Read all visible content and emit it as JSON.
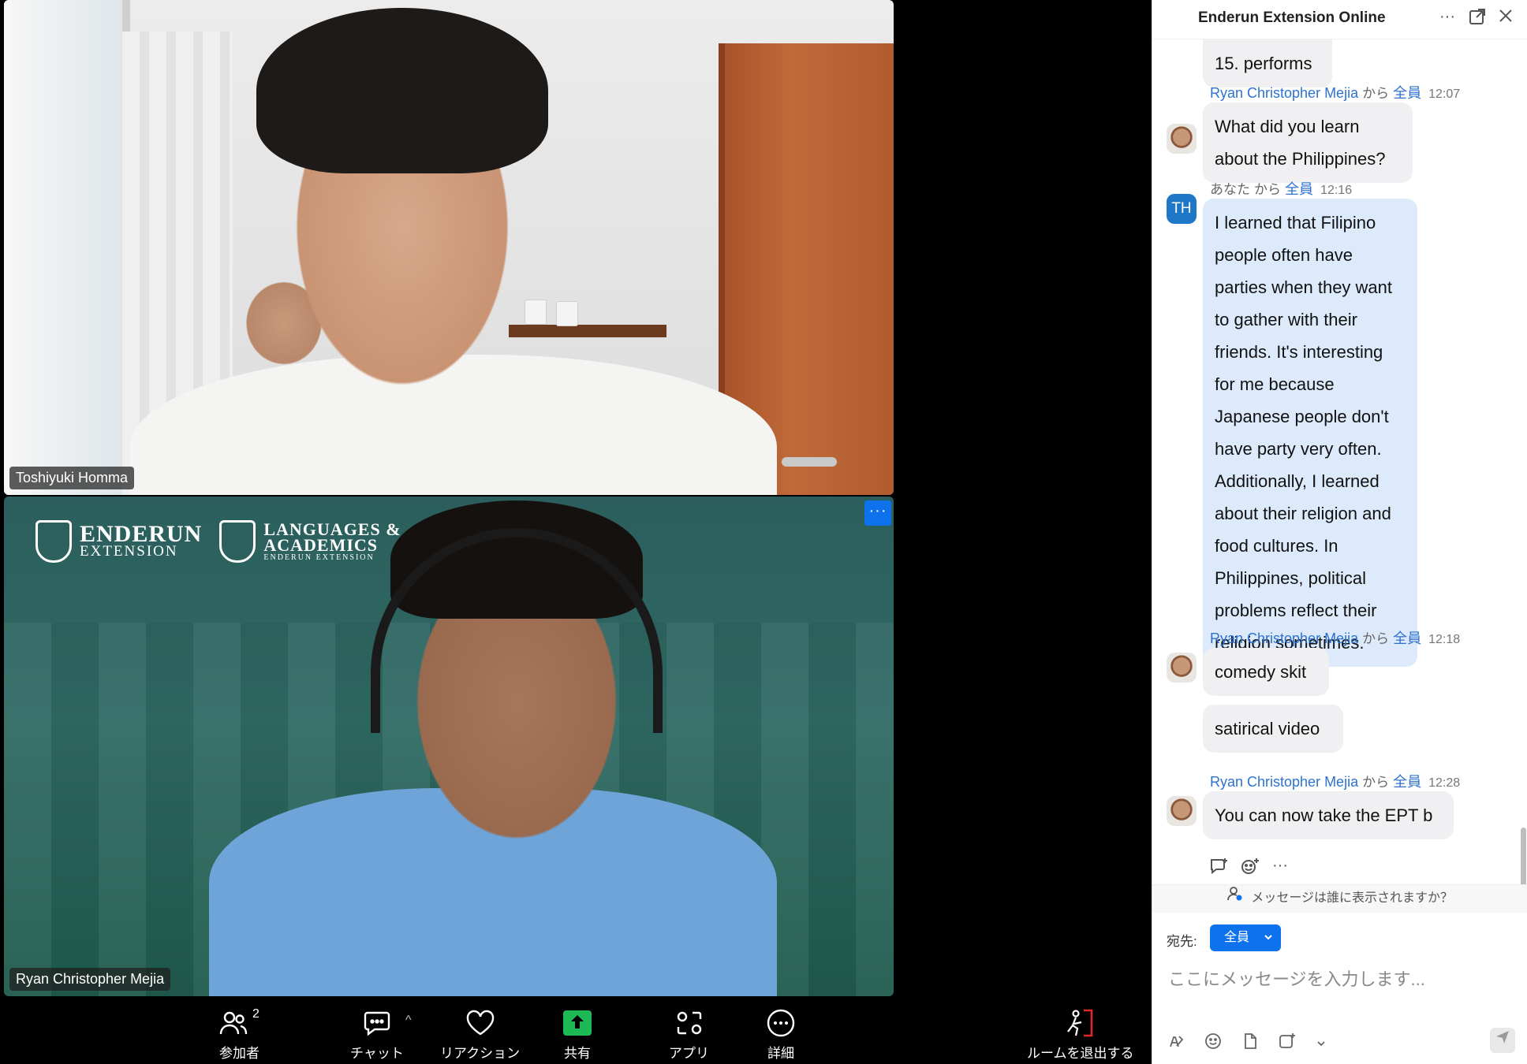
{
  "participants": {
    "top": {
      "name": "Toshiyuki Homma"
    },
    "bottom": {
      "name": "Ryan Christopher Mejia",
      "more_label": "···",
      "background_logo": {
        "brand1_main": "ENDERUN",
        "brand1_sub": "EXTENSION",
        "brand2_line1": "LANGUAGES &",
        "brand2_line2": "ACADEMICS",
        "brand2_small": "ENDERUN EXTENSION"
      }
    }
  },
  "toolbar": {
    "participants": {
      "label": "参加者",
      "count": "2",
      "icon": "participants-icon"
    },
    "chat": {
      "label": "チャット",
      "icon": "chat-icon",
      "caret": "^"
    },
    "reactions": {
      "label": "リアクション",
      "icon": "heart-icon"
    },
    "share": {
      "label": "共有",
      "icon": "share-icon"
    },
    "apps": {
      "label": "アプリ",
      "icon": "apps-icon"
    },
    "more": {
      "label": "詳細",
      "icon": "more-icon"
    },
    "leave": {
      "label": "ルームを退出する",
      "icon": "leave-room-icon"
    }
  },
  "chat": {
    "title": "Enderun Extension Online",
    "header_more": "···",
    "messages": [
      {
        "text": "15. performs"
      },
      {
        "sender": "Ryan Christopher Mejia",
        "from": "から",
        "to": "全員",
        "time": "12:07",
        "text": "What did you learn about the Philippines?"
      },
      {
        "sender": "あなた",
        "from": "から",
        "to": "全員",
        "time": "12:16",
        "avatar_initials": "TH",
        "text": "I learned that Filipino people often have parties when they want to gather with their friends. It's interesting for me because Japanese people don't have party very often. Additionally, I learned about their religion and food cultures. In Philippines, political problems reflect their religion sometimes."
      },
      {
        "sender": "Ryan Christopher Mejia",
        "from": "から",
        "to": "全員",
        "time": "12:18",
        "text": "comedy skit"
      },
      {
        "text": "satirical video"
      },
      {
        "sender": "Ryan Christopher Mejia",
        "from": "から",
        "to": "全員",
        "time": "12:28",
        "text": "You can now take the EPT b"
      }
    ],
    "visibility_note": "メッセージは誰に表示されますか？",
    "composer": {
      "to_label": "宛先:",
      "to_value": "全員",
      "placeholder": "ここにメッセージを入力します..."
    }
  },
  "colors": {
    "accent": "#0e72ed",
    "share_green": "#1db954",
    "leave_red": "#e02828",
    "link_blue": "#2d72d2",
    "my_bubble": "#dceafb",
    "their_bubble": "#f0f0f2"
  }
}
